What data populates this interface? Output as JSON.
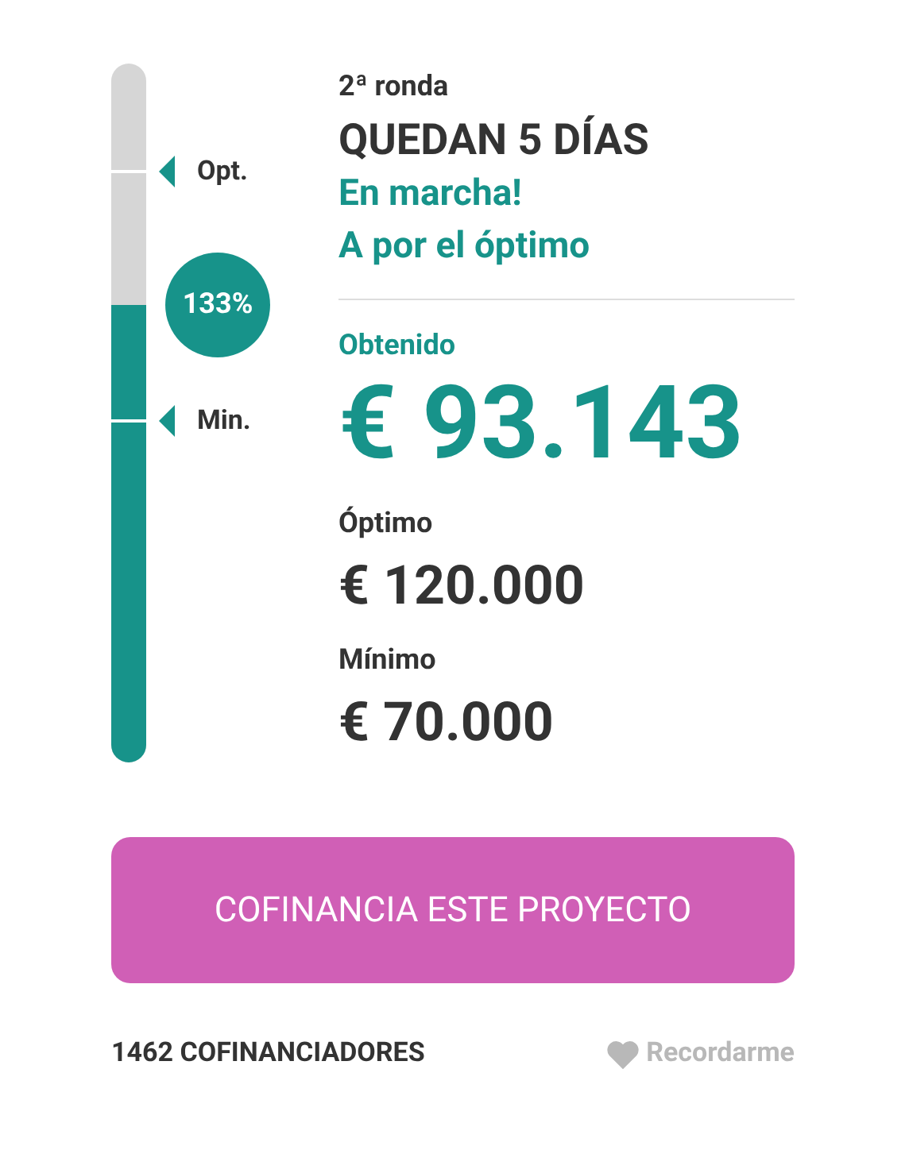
{
  "progress": {
    "level": 0.655,
    "percent": "133%",
    "markers": [
      {
        "label": "Opt."
      },
      {
        "label": "Min."
      }
    ]
  },
  "round": "2ª ronda",
  "days_left": "QUEDAN 5 DÍAS",
  "status": [
    "En marcha!",
    "A por el óptimo"
  ],
  "stats": [
    {
      "label": "Obtenido",
      "value": "€ 93.143",
      "kind": "main"
    },
    {
      "label": "Óptimo",
      "value": "€ 120.000",
      "kind": "secondary"
    },
    {
      "label": "Mínimo",
      "value": "€ 70.000",
      "kind": "secondary"
    }
  ],
  "cta_button": "COFINANCIA ESTE PROYECTO",
  "backers": "1462 COFINANCIADORES",
  "remind_link": "Recordarme"
}
